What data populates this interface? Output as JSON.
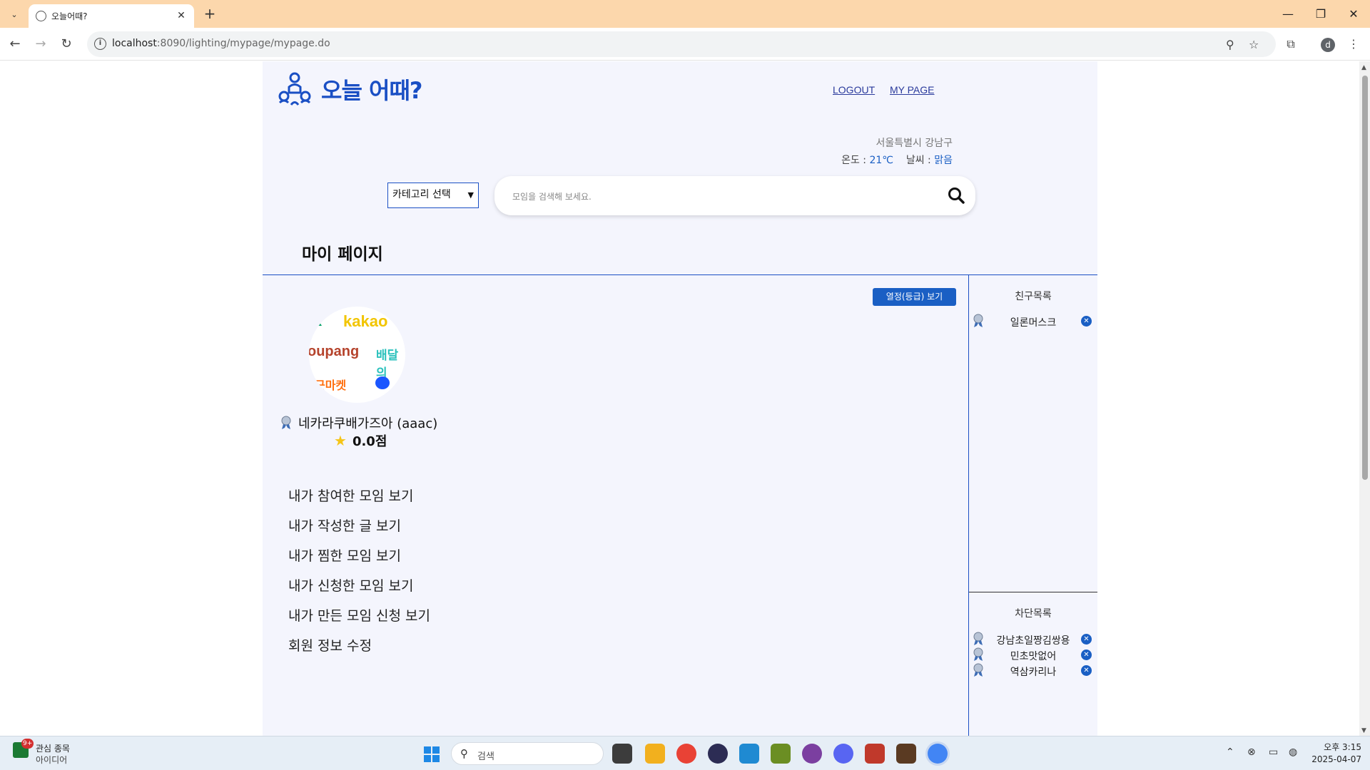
{
  "browser": {
    "tab_title": "오늘어때?",
    "url_host": "localhost",
    "url_rest": ":8090/lighting/mypage/mypage.do",
    "profile_initial": "d"
  },
  "header": {
    "logo_text": "오늘 어때?",
    "nav": [
      "LOGOUT",
      "MY PAGE"
    ]
  },
  "weather": {
    "location": "서울특별시 강남구",
    "temp_label": "온도 : ",
    "temp_value": "21℃",
    "weather_label": "날씨 : ",
    "weather_value": "맑음"
  },
  "search": {
    "category_selected": "카테고리 선택",
    "placeholder": "모임을 검색해 보세요."
  },
  "page": {
    "title": "마이 페이지",
    "grade_button": "열정(등급) 보기"
  },
  "profile": {
    "image_words": [
      "kakao",
      "oupang",
      "배달의",
      "근마켓"
    ],
    "name": "네카라쿠배가즈아 (aaac)",
    "score": "0.0점"
  },
  "menu": [
    "내가 참여한 모임 보기",
    "내가 작성한 글 보기",
    "내가 찜한 모임 보기",
    "내가 신청한 모임 보기",
    "내가 만든 모임 신청 보기",
    "회원 정보 수정"
  ],
  "friends": {
    "title": "친구목록",
    "items": [
      "일론머스크"
    ]
  },
  "blocked": {
    "title": "차단목록",
    "items": [
      "강남초일짱김쌍용",
      "민초맛없어",
      "역삼카리나"
    ]
  },
  "taskbar": {
    "widget_title": "관심 종목",
    "widget_sub": "아이디어",
    "widget_badge": "9+",
    "search_label": "검색",
    "time": "오후 3:15",
    "date": "2025-04-07"
  },
  "colors": {
    "accent": "#1a4fc4",
    "page_bg": "#f4f5fd",
    "tab_bar": "#fcd7ac"
  }
}
